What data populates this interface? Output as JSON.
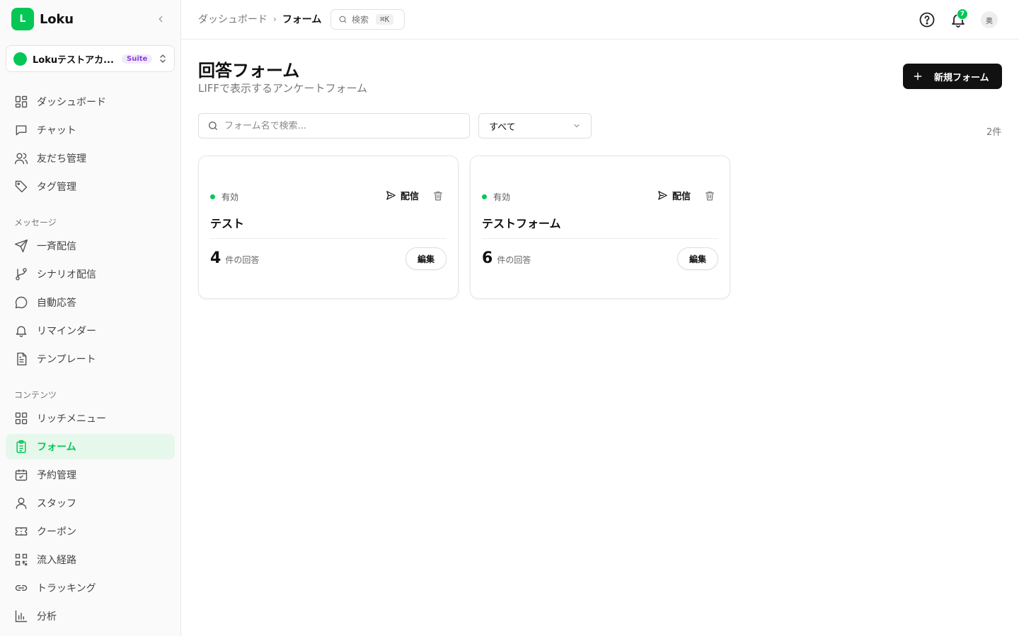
{
  "brand": {
    "logo_letter": "L",
    "name": "Loku"
  },
  "account": {
    "name": "Lokuテストアカ...",
    "badge": "Suite"
  },
  "nav": {
    "main": [
      {
        "label": "ダッシュボード",
        "icon": "grid-icon"
      },
      {
        "label": "チャット",
        "icon": "chat-icon"
      },
      {
        "label": "友だち管理",
        "icon": "users-icon"
      },
      {
        "label": "タグ管理",
        "icon": "tag-icon"
      }
    ],
    "section_message": "メッセージ",
    "message": [
      {
        "label": "一斉配信",
        "icon": "send-icon"
      },
      {
        "label": "シナリオ配信",
        "icon": "branch-icon"
      },
      {
        "label": "自動応答",
        "icon": "speech-bubble-icon"
      },
      {
        "label": "リマインダー",
        "icon": "bell-icon"
      },
      {
        "label": "テンプレート",
        "icon": "document-icon"
      }
    ],
    "section_content": "コンテンツ",
    "content": [
      {
        "label": "リッチメニュー",
        "icon": "grid-icon"
      },
      {
        "label": "フォーム",
        "icon": "clipboard-icon",
        "active": true
      },
      {
        "label": "予約管理",
        "icon": "calendar-check-icon"
      },
      {
        "label": "スタッフ",
        "icon": "person-icon"
      },
      {
        "label": "クーポン",
        "icon": "ticket-icon"
      },
      {
        "label": "流入経路",
        "icon": "qr-code-icon"
      },
      {
        "label": "トラッキング",
        "icon": "link-icon"
      },
      {
        "label": "分析",
        "icon": "bar-chart-icon"
      }
    ]
  },
  "topbar": {
    "breadcrumb": [
      "ダッシュボード",
      "フォーム"
    ],
    "search_label": "検索",
    "search_shortcut": "⌘K",
    "notification_count": "7",
    "avatar_initial": "奥"
  },
  "page": {
    "title": "回答フォーム",
    "subtitle": "LIFFで表示するアンケートフォーム",
    "new_button": "新規フォーム",
    "search_placeholder": "フォーム名で検索...",
    "filter_value": "すべて",
    "count": "2件"
  },
  "forms": [
    {
      "status": "有効",
      "send_label": "配信",
      "name": "テスト",
      "responses": "4",
      "responses_unit": "件の回答",
      "edit_label": "編集"
    },
    {
      "status": "有効",
      "send_label": "配信",
      "name": "テストフォーム",
      "responses": "6",
      "responses_unit": "件の回答",
      "edit_label": "編集"
    }
  ],
  "colors": {
    "accent": "#06c755",
    "active_bg": "#e6f7ec",
    "primary_button": "#111111",
    "badge_text": "#8b3fd9"
  }
}
